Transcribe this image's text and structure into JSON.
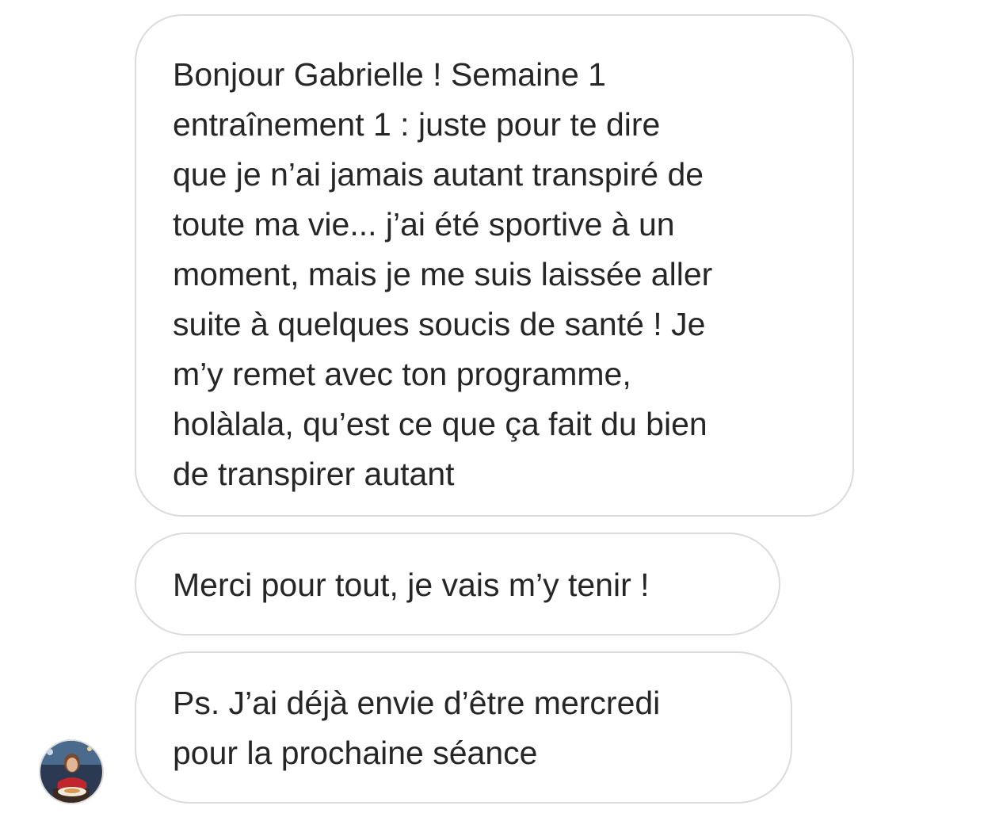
{
  "conversation": {
    "messages": [
      {
        "text": "Bonjour Gabrielle ! Semaine 1\nentraînement 1 : juste pour te dire\nque je n’ai jamais autant transpiré de\ntoute ma vie... j’ai été sportive à un\nmoment, mais je me suis laissée aller\nsuite à quelques soucis de santé ! Je\nm’y remet avec ton programme,\nholàlala, qu’est ce que ça fait du bien\nde transpirer autant"
      },
      {
        "text": "Merci pour tout, je vais m’y tenir !"
      },
      {
        "text": "Ps. J’ai déjà envie d’être mercredi\npour la prochaine séance"
      }
    ],
    "sender_avatar": {
      "icon": "profile-photo"
    }
  },
  "colors": {
    "bubble_border": "#dbdbdb",
    "text": "#262626",
    "background": "#ffffff"
  }
}
